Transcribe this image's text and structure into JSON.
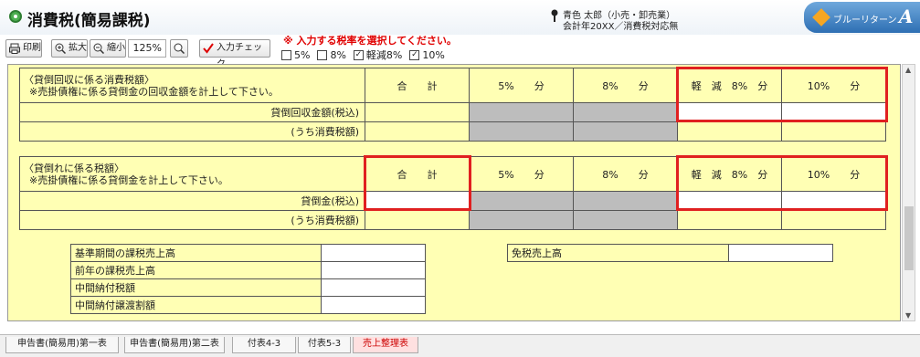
{
  "window": {
    "title": "消費税(簡易課税)",
    "user_line1": "青色 太郎（小売・卸売業）",
    "user_line2": "会計年20XX／消費税対応無",
    "logo_text": "ブルーリターン",
    "logo_letter": "A"
  },
  "toolbar": {
    "print_label": "印刷",
    "zoom_in_label": "拡大",
    "zoom_out_label": "縮小",
    "zoom_value": "125%",
    "check_label": "入力チェック"
  },
  "rate_select": {
    "prompt": "※ 入力する税率を選択してください。",
    "options": [
      {
        "label": "5%",
        "checked": false
      },
      {
        "label": "8%",
        "checked": false
      },
      {
        "label": "軽減8%",
        "checked": true
      },
      {
        "label": "10%",
        "checked": true
      }
    ]
  },
  "section1": {
    "title": "〈貸倒回収に係る消費税額〉",
    "note": "※売掛債権に係る貸倒金の回収金額を計上して下さい。",
    "headers": [
      "合　　計",
      "5%　　分",
      "8%　　分",
      "軽　減　8%　分",
      "10%　　分"
    ],
    "rows": [
      "貸倒回収金額(税込)",
      "(うち消費税額)"
    ]
  },
  "section2": {
    "title": "〈貸倒れに係る税額〉",
    "note": "※売掛債権に係る貸倒金を計上して下さい。",
    "headers": [
      "合　　計",
      "5%　　分",
      "8%　　分",
      "軽　減　8%　分",
      "10%　　分"
    ],
    "rows": [
      "貸倒金(税込)",
      "(うち消費税額)"
    ]
  },
  "bottom_left": [
    "基準期間の課税売上高",
    "前年の課税売上高",
    "中間納付税額",
    "中間納付譲渡割額"
  ],
  "bottom_right": [
    "免税売上高"
  ],
  "tabs": [
    "申告書(簡易用)第一表",
    "申告書(簡易用)第二表",
    "付表4-3",
    "付表5-3",
    "売上整理表"
  ]
}
